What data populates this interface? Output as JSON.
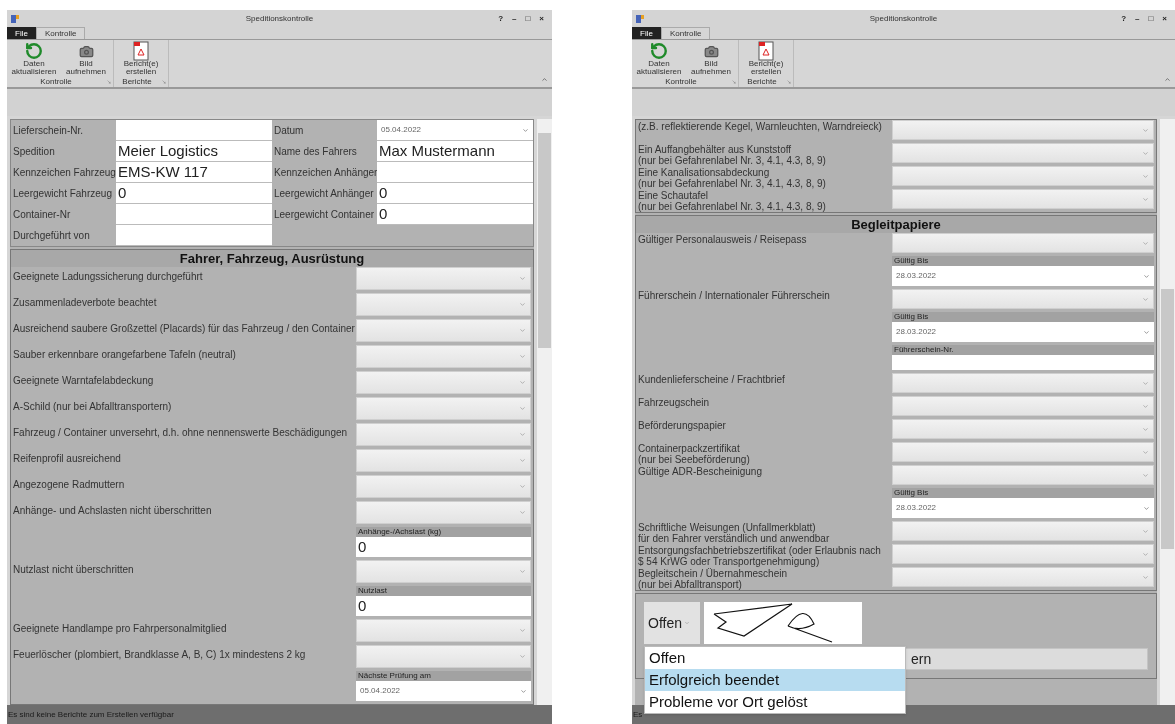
{
  "windows": [
    {
      "title": "Speditionskontrolle",
      "title_buttons": [
        "?",
        "–",
        "□",
        "×"
      ],
      "tabs": [
        {
          "label": "File",
          "kind": "file"
        },
        {
          "label": "Kontrolle",
          "kind": "tab",
          "selected": true
        }
      ],
      "ribbon_groups": [
        {
          "label": "Kontrolle",
          "buttons": [
            {
              "label": "Daten aktualisieren",
              "kind": "refresh"
            },
            {
              "label": "Bild aufnehmen",
              "kind": "camera"
            }
          ]
        },
        {
          "label": "Berichte",
          "buttons": [
            {
              "label": "Bericht(e) erstellen",
              "kind": "pdf"
            }
          ]
        }
      ],
      "header_fields": [
        [
          {
            "label": "Lieferschein-Nr.",
            "kind": "text"
          },
          {
            "label": "Datum",
            "kind": "date",
            "value": "05.04.2022"
          }
        ],
        [
          {
            "label": "Spedition",
            "kind": "text",
            "value": "Meier Logistics"
          },
          {
            "label": "Name des Fahrers",
            "kind": "text",
            "value": "Max Mustermann"
          }
        ],
        [
          {
            "label": "Kennzeichen Fahrzeug",
            "kind": "text",
            "value": "EMS-KW 117"
          },
          {
            "label": "Kennzeichen Anhänger",
            "kind": "text"
          }
        ],
        [
          {
            "label": "Leergewicht Fahrzeug",
            "kind": "text",
            "value": "0"
          },
          {
            "label": "Leergewicht Anhänger",
            "kind": "text",
            "value": "0"
          }
        ],
        [
          {
            "label": "Container-Nr",
            "kind": "text"
          },
          {
            "label": "Leergewicht Container",
            "kind": "text",
            "value": "0"
          }
        ],
        [
          {
            "label": "Durchgeführt von",
            "kind": "text"
          }
        ]
      ],
      "sections": [
        {
          "title": "Fahrer, Fahrzeug, Ausrüstung",
          "rows": [
            {
              "label": "Geeignete Ladungssicherung durchgeführt",
              "controls": [
                {
                  "kind": "select"
                }
              ]
            },
            {
              "label": "Zusammenladeverbote beachtet",
              "controls": [
                {
                  "kind": "select"
                }
              ]
            },
            {
              "label": "Ausreichend saubere Großzettel (Placards) für das Fahrzeug / den Container",
              "controls": [
                {
                  "kind": "select"
                }
              ]
            },
            {
              "label": "Sauber erkennbare orangefarbene Tafeln (neutral)",
              "controls": [
                {
                  "kind": "select"
                }
              ]
            },
            {
              "label": "Geeignete Warntafelabdeckung",
              "controls": [
                {
                  "kind": "select"
                }
              ]
            },
            {
              "label": "A-Schild (nur bei Abfalltransportern)",
              "controls": [
                {
                  "kind": "select"
                }
              ]
            },
            {
              "label": "Fahrzeug / Container unversehrt, d.h. ohne nennenswerte Beschädigungen",
              "controls": [
                {
                  "kind": "select"
                }
              ]
            },
            {
              "label": "Reifenprofil ausreichend",
              "controls": [
                {
                  "kind": "select"
                }
              ]
            },
            {
              "label": "Angezogene Radmuttern",
              "controls": [
                {
                  "kind": "select"
                }
              ]
            },
            {
              "label": "Anhänge- und Achslasten nicht überschritten",
              "controls": [
                {
                  "kind": "select"
                },
                {
                  "kind": "number",
                  "caption": "Anhänge-/Achslast (kg)",
                  "value": "0"
                }
              ]
            },
            {
              "label": "Nutzlast nicht überschritten",
              "controls": [
                {
                  "kind": "select"
                },
                {
                  "kind": "number",
                  "caption": "Nutzlast",
                  "value": "0"
                }
              ]
            },
            {
              "label": "Geeignete Handlampe pro Fahrpersonalmitglied",
              "controls": [
                {
                  "kind": "select"
                }
              ]
            },
            {
              "label": "Feuerlöscher (plombiert, Brandklasse A, B, C) 1x mindestens 2 kg",
              "controls": [
                {
                  "kind": "select"
                },
                {
                  "kind": "date",
                  "caption": "Nächste Prüfung am",
                  "value": "05.04.2022"
                }
              ]
            }
          ]
        }
      ],
      "status_bar": "Es sind keine Berichte zum Erstellen verfügbar"
    },
    {
      "title": "Speditionskontrolle",
      "title_buttons": [
        "?",
        "–",
        "□",
        "×"
      ],
      "tabs": [
        {
          "label": "File",
          "kind": "file"
        },
        {
          "label": "Kontrolle",
          "kind": "tab",
          "selected": true
        }
      ],
      "ribbon_groups": [
        {
          "label": "Kontrolle",
          "buttons": [
            {
              "label": "Daten aktualisieren",
              "kind": "refresh"
            },
            {
              "label": "Bild aufnehmen",
              "kind": "camera"
            }
          ]
        },
        {
          "label": "Berichte",
          "buttons": [
            {
              "label": "Bericht(e) erstellen",
              "kind": "pdf"
            }
          ]
        }
      ],
      "sections": [
        {
          "rows": [
            {
              "label": "(z.B. reflektierende Kegel, Warnleuchten, Warndreieck)",
              "controls": [
                {
                  "kind": "select"
                }
              ]
            },
            {
              "label": "Ein Auffangbehälter aus Kunststoff\n(nur bei Gefahrenlabel Nr. 3, 4.1, 4.3, 8, 9)",
              "controls": [
                {
                  "kind": "select"
                }
              ]
            },
            {
              "label": "Eine Kanalisationsabdeckung\n(nur bei Gefahrenlabel Nr. 3, 4.1, 4.3, 8, 9)",
              "controls": [
                {
                  "kind": "select"
                }
              ]
            },
            {
              "label": "Eine Schautafel\n(nur bei Gefahrenlabel Nr. 3, 4.1, 4.3, 8, 9)",
              "controls": [
                {
                  "kind": "select"
                }
              ]
            }
          ]
        },
        {
          "title": "Begleitpapiere",
          "rows": [
            {
              "label": "Gültiger Personalausweis / Reisepass",
              "controls": [
                {
                  "kind": "select"
                },
                {
                  "kind": "date",
                  "caption": "Gültig Bis",
                  "value": "28.03.2022"
                }
              ]
            },
            {
              "label": "Führerschein / Internationaler Führerschein",
              "controls": [
                {
                  "kind": "select"
                },
                {
                  "kind": "date",
                  "caption": "Gültig Bis",
                  "value": "28.03.2022"
                },
                {
                  "kind": "text",
                  "caption": "Führerschein-Nr."
                }
              ]
            },
            {
              "label": "Kundenlieferscheine / Frachtbrief",
              "controls": [
                {
                  "kind": "select"
                }
              ]
            },
            {
              "label": "Fahrzeugschein",
              "controls": [
                {
                  "kind": "select"
                }
              ]
            },
            {
              "label": "Beförderungspapier",
              "controls": [
                {
                  "kind": "select"
                }
              ]
            },
            {
              "label": "Containerpackzertifikat\n(nur bei Seebeförderung)",
              "controls": [
                {
                  "kind": "select"
                }
              ]
            },
            {
              "label": "Gültige ADR-Bescheinigung",
              "controls": [
                {
                  "kind": "select"
                },
                {
                  "kind": "date",
                  "caption": "Gültig Bis",
                  "value": "28.03.2022"
                }
              ]
            },
            {
              "label": "Schriftliche Weisungen (Unfallmerkblatt)\nfür den Fahrer verständlich und anwendbar",
              "controls": [
                {
                  "kind": "select"
                }
              ]
            },
            {
              "label": "Entsorgungsfachbetriebszertifikat (oder Erlaubnis nach\n$ 54 KrWG oder Transportgenehmigung)",
              "controls": [
                {
                  "kind": "select"
                }
              ]
            },
            {
              "label": "Begleitschein / Übernahmeschein\n(nur bei Abfalltransport)",
              "controls": [
                {
                  "kind": "select"
                }
              ]
            }
          ]
        }
      ],
      "footer": {
        "status": "Offen",
        "button": "ern",
        "dropdown": [
          {
            "label": "Offen",
            "selected": false
          },
          {
            "label": "Erfolgreich beendet",
            "selected": true
          },
          {
            "label": "Probleme vor Ort gelöst",
            "selected": false
          }
        ]
      },
      "status_bar": "Es"
    }
  ]
}
